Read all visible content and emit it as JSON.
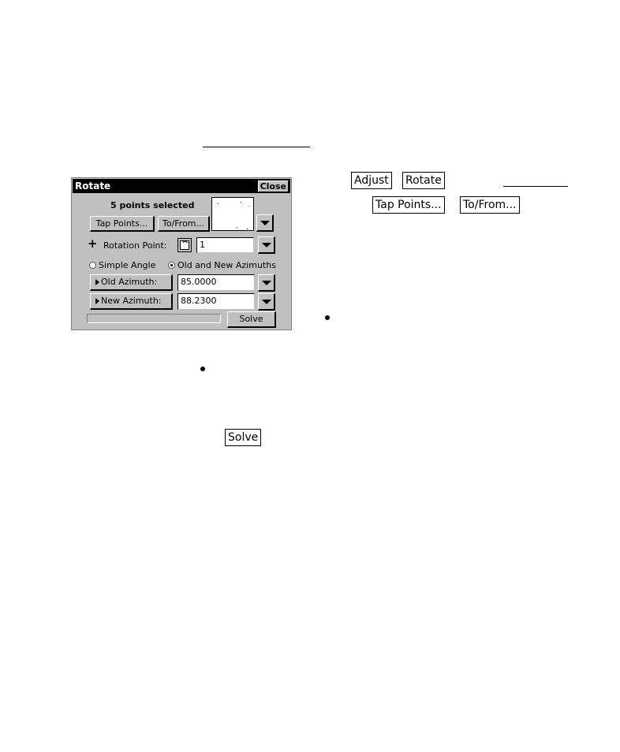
{
  "document": {
    "inline_buttons": {
      "adjust": "Adjust",
      "rotate": "Rotate",
      "tap_points": "Tap Points...",
      "to_from": "To/From...",
      "solve": "Solve"
    }
  },
  "dialog": {
    "title": "Rotate",
    "close_label": "Close",
    "selection_status": "5 points selected",
    "tap_points_label": "Tap Points...",
    "to_from_label": "To/From...",
    "rotation_point_label": "Rotation Point:",
    "rotation_point_value": "1",
    "mode_options": [
      {
        "label": "Simple Angle",
        "selected": false
      },
      {
        "label": "Old and New Azimuths",
        "selected": true
      }
    ],
    "old_azimuth_label": "Old Azimuth:",
    "old_azimuth_value": "85.0000",
    "new_azimuth_label": "New Azimuth:",
    "new_azimuth_value": "88.2300",
    "solve_label": "Solve",
    "progress": 0
  }
}
